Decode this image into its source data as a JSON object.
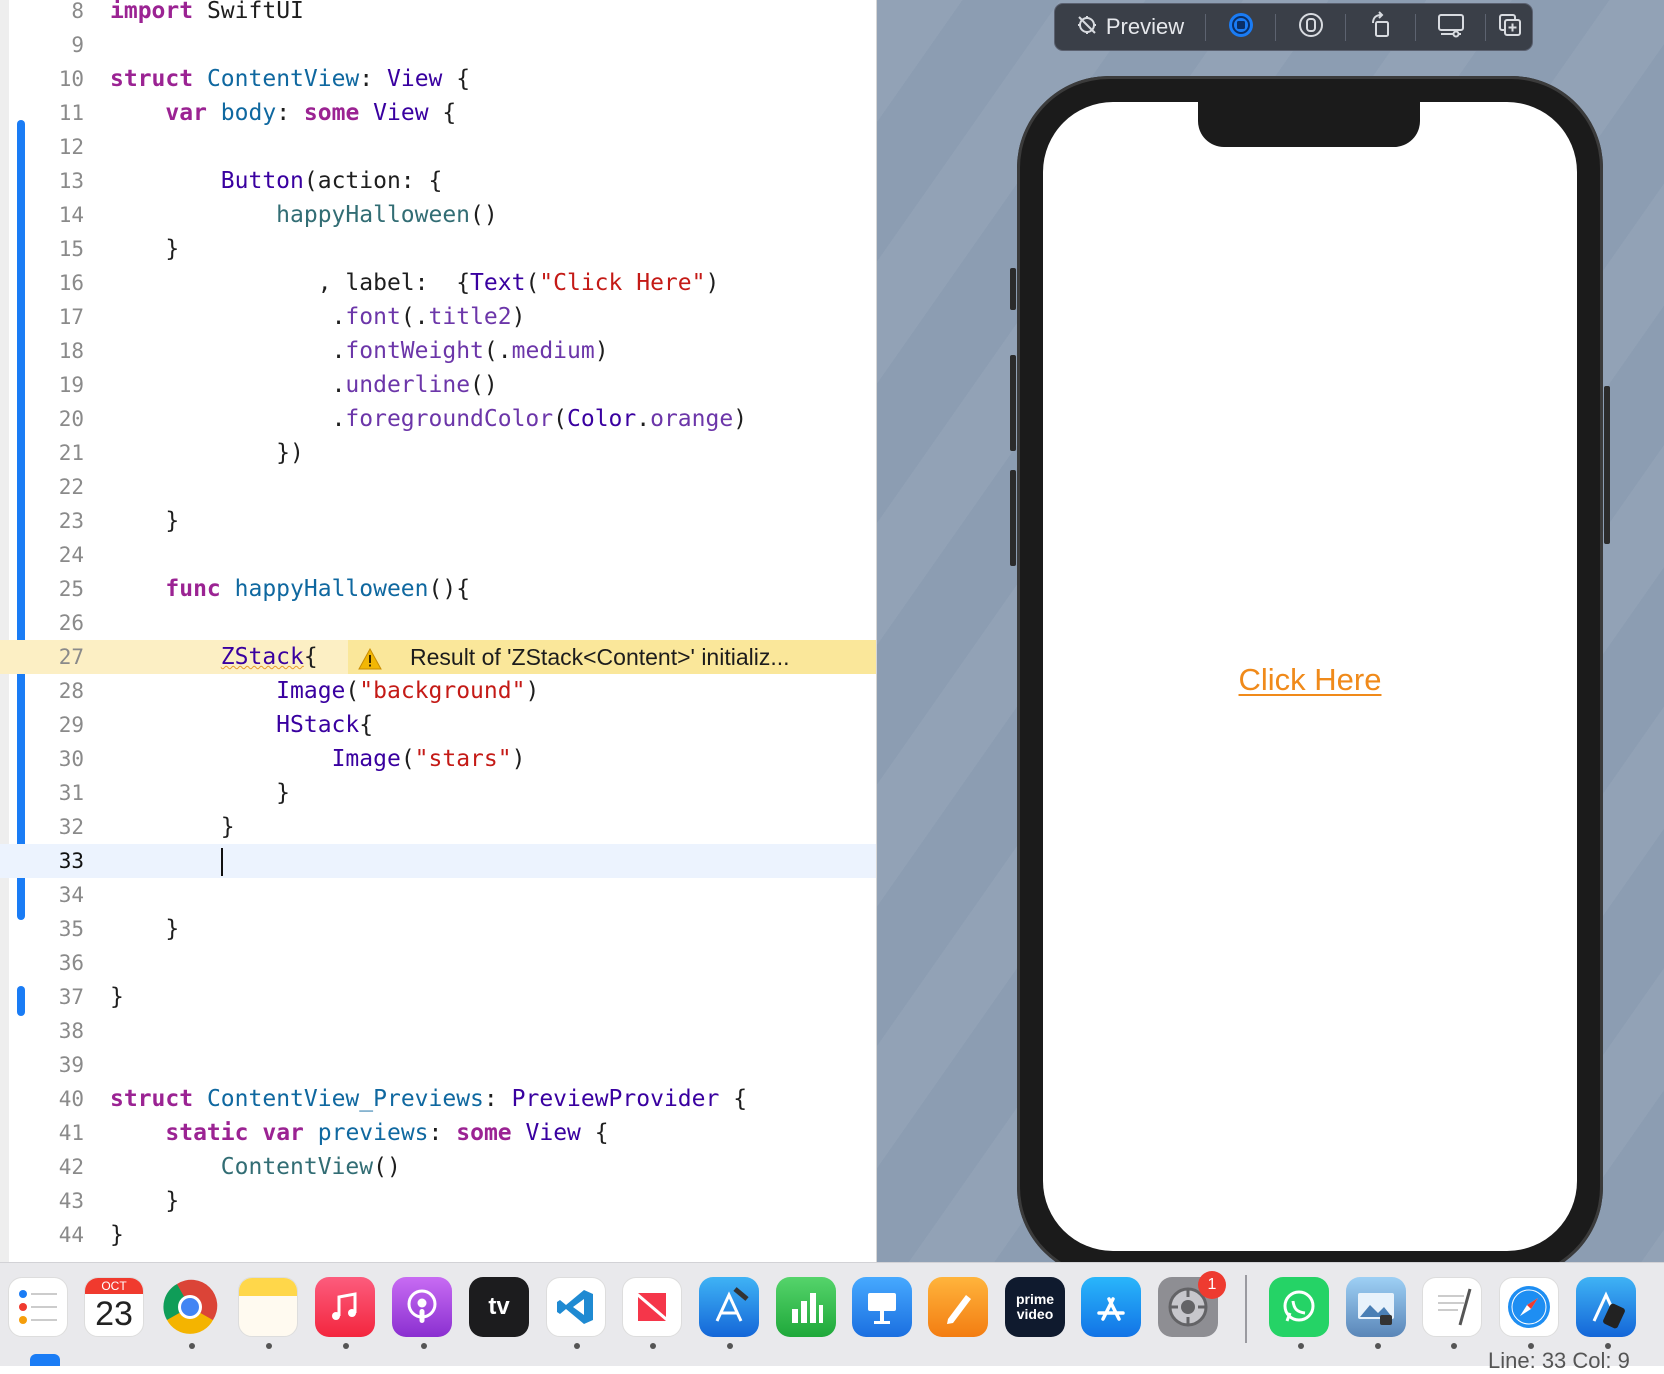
{
  "editor": {
    "lines": [
      {
        "n": "8"
      },
      {
        "n": "9"
      },
      {
        "n": "10"
      },
      {
        "n": "11"
      },
      {
        "n": "12"
      },
      {
        "n": "13"
      },
      {
        "n": "14"
      },
      {
        "n": "15"
      },
      {
        "n": "16"
      },
      {
        "n": "17"
      },
      {
        "n": "18"
      },
      {
        "n": "19"
      },
      {
        "n": "20"
      },
      {
        "n": "21"
      },
      {
        "n": "22"
      },
      {
        "n": "23"
      },
      {
        "n": "24"
      },
      {
        "n": "25"
      },
      {
        "n": "26"
      },
      {
        "n": "27"
      },
      {
        "n": "28"
      },
      {
        "n": "29"
      },
      {
        "n": "30"
      },
      {
        "n": "31"
      },
      {
        "n": "32"
      },
      {
        "n": "33"
      },
      {
        "n": "34"
      },
      {
        "n": "35"
      },
      {
        "n": "36"
      },
      {
        "n": "37"
      },
      {
        "n": "38"
      },
      {
        "n": "39"
      },
      {
        "n": "40"
      },
      {
        "n": "41"
      },
      {
        "n": "42"
      },
      {
        "n": "43"
      },
      {
        "n": "44"
      }
    ],
    "tokens": {
      "import_kw": "import",
      "swiftui": "SwiftUI",
      "struct_kw": "struct",
      "contentview": "ContentView",
      "colon": ":",
      "view": "View",
      "open_brace": "{",
      "close_brace": "}",
      "var_kw": "var",
      "body": "body",
      "some_kw": "some",
      "button": "Button",
      "action": "(action: {",
      "happy_call": "happyHalloween",
      "parens": "()",
      "label_part": ", label:  {",
      "text": "Text",
      "open_paren": "(",
      "close_paren": ")",
      "click_here_str": "\"Click Here\"",
      "dot": ".",
      "font": "font",
      "title2": "title2",
      "font_weight": "fontWeight",
      "medium": "medium",
      "underline": "underline",
      "foreground_color": "foregroundColor",
      "color": "Color",
      "orange": "orange",
      "close_label": "})",
      "func_kw": "func",
      "happy_decl": "happyHalloween",
      "parens_brace": "(){",
      "zstack": "ZStack",
      "image": "Image",
      "background_str": "\"background\"",
      "hstack": "HStack",
      "stars_str": "\"stars\"",
      "previews_struct": "ContentView_Previews",
      "preview_provider": "PreviewProvider",
      "static_kw": "static",
      "previews": "previews",
      "contentview_call": "ContentView"
    },
    "warning": "Result of 'ZStack<Content>' initializ...",
    "warning_icon": "warning-triangle-icon",
    "current_line": "33"
  },
  "preview": {
    "toolbar_label": "Preview",
    "button_text": "Click Here",
    "button_color": "#f08a1a"
  },
  "dock": {
    "calendar_month": "OCT",
    "calendar_day": "23",
    "system_prefs_badge": "1",
    "apps": [
      "Reminders",
      "Calendar",
      "Chrome",
      "Notes",
      "Music",
      "Podcasts",
      "Apple TV",
      "Visual Studio Code",
      "News",
      "Xcode",
      "Numbers",
      "Keynote",
      "Pages",
      "Prime Video",
      "App Store",
      "System Preferences",
      "WhatsApp",
      "Preview",
      "TextEdit",
      "Safari",
      "Simulator"
    ]
  },
  "status_bar": {
    "line_col": "Line: 33  Col: 9"
  },
  "colors": {
    "accent": "#1a7cf5",
    "warning": "#fae79a",
    "canvas": "#8c9db2"
  }
}
